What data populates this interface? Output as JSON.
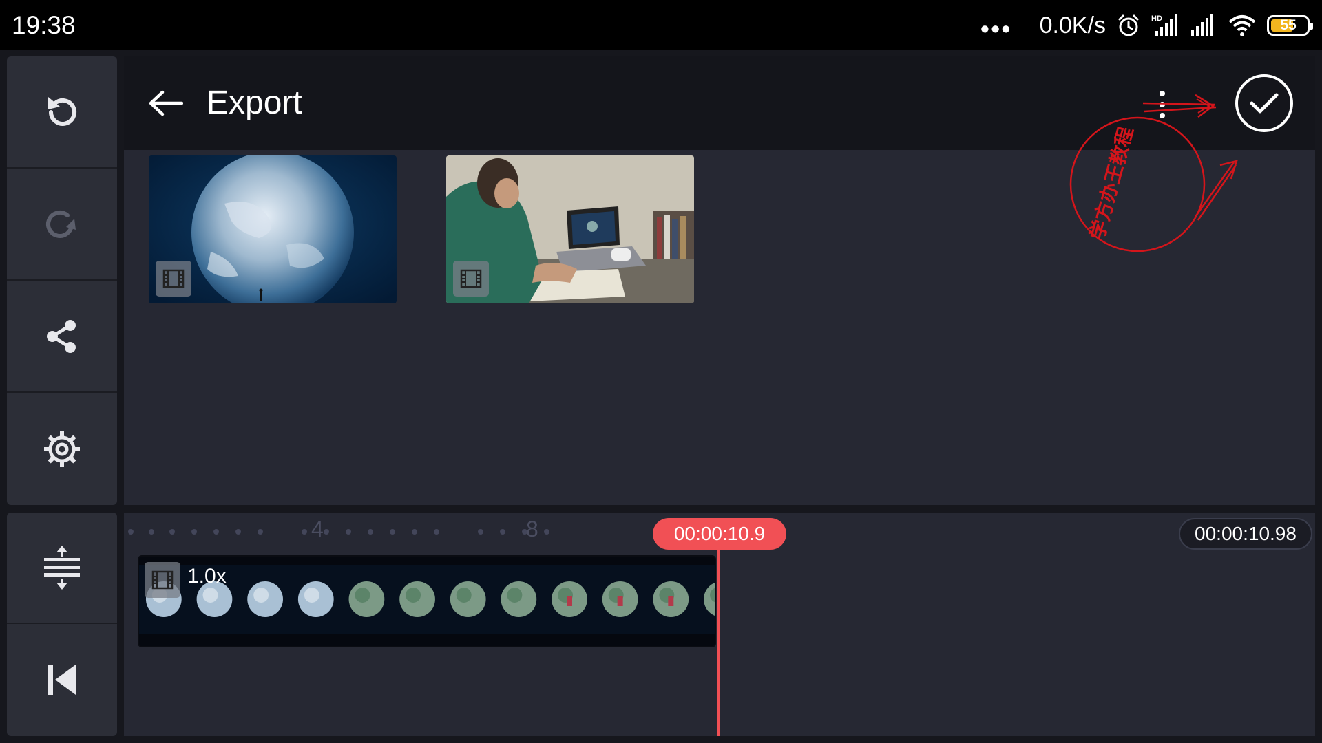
{
  "status_bar": {
    "time": "19:38",
    "dots": "•••",
    "net_speed": "0.0K/s",
    "battery": "55",
    "icons": [
      "alarm-icon",
      "hd-signal-icon",
      "signal-icon",
      "wifi-icon",
      "battery-icon"
    ]
  },
  "sidebar": {
    "top_items": [
      {
        "name": "undo",
        "icon": "undo-icon"
      },
      {
        "name": "redo",
        "icon": "redo-icon",
        "disabled": true
      },
      {
        "name": "share",
        "icon": "share-icon"
      },
      {
        "name": "settings",
        "icon": "gear-icon"
      }
    ],
    "bottom_items": [
      {
        "name": "expand-timeline",
        "icon": "expand-vertical-icon"
      },
      {
        "name": "skip-to-start",
        "icon": "skip-to-start-icon"
      }
    ]
  },
  "header": {
    "title": "Export",
    "back_icon": "arrow-left-icon",
    "more_icon": "more-vertical-icon",
    "confirm_icon": "check-circle-icon"
  },
  "media": [
    {
      "name": "earth-clip",
      "icon": "film-icon"
    },
    {
      "name": "desk-clip",
      "icon": "film-icon"
    }
  ],
  "stamp": {
    "text": "学方办王教程"
  },
  "timeline": {
    "ruler_labels": [
      "4",
      "8"
    ],
    "playhead_time": "00:00:10.9",
    "total_time": "00:00:10.98",
    "clip_speed": "1.0x",
    "accent_color": "#f15055"
  }
}
